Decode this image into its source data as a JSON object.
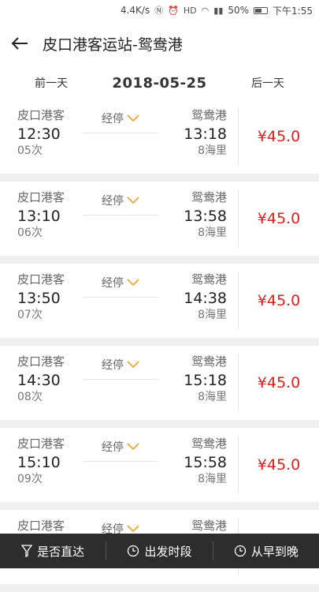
{
  "status_bar": {
    "speed": "4.4K/s",
    "battery": "50%",
    "time": "下午1:55"
  },
  "header": {
    "title": "皮口港客运站-鸳鸯港"
  },
  "date_nav": {
    "prev": "前一天",
    "date": "2018-05-25",
    "next": "后一天"
  },
  "trips": [
    {
      "from": "皮口港客",
      "dep_time": "12:30",
      "trip_no": "05次",
      "stops": "经停",
      "to": "鸳鸯港",
      "arr_time": "13:18",
      "distance": "8海里",
      "price": "¥45.0"
    },
    {
      "from": "皮口港客",
      "dep_time": "13:10",
      "trip_no": "06次",
      "stops": "经停",
      "to": "鸳鸯港",
      "arr_time": "13:58",
      "distance": "8海里",
      "price": "¥45.0"
    },
    {
      "from": "皮口港客",
      "dep_time": "13:50",
      "trip_no": "07次",
      "stops": "经停",
      "to": "鸳鸯港",
      "arr_time": "14:38",
      "distance": "8海里",
      "price": "¥45.0"
    },
    {
      "from": "皮口港客",
      "dep_time": "14:30",
      "trip_no": "08次",
      "stops": "经停",
      "to": "鸳鸯港",
      "arr_time": "15:18",
      "distance": "8海里",
      "price": "¥45.0"
    },
    {
      "from": "皮口港客",
      "dep_time": "15:10",
      "trip_no": "09次",
      "stops": "经停",
      "to": "鸳鸯港",
      "arr_time": "15:58",
      "distance": "8海里",
      "price": "¥45.0"
    },
    {
      "from": "皮口港客",
      "dep_time": "",
      "trip_no": "",
      "stops": "经停",
      "to": "鸳鸯港",
      "arr_time": "",
      "distance": "",
      "price": ""
    }
  ],
  "bottom_bar": {
    "filter_direct": "是否直达",
    "departure_period": "出发时段",
    "sort": "从早到晚"
  },
  "colors": {
    "price": "#e0201e",
    "chevron": "#f0a020",
    "bottom_bar": "#2d2d2d"
  }
}
